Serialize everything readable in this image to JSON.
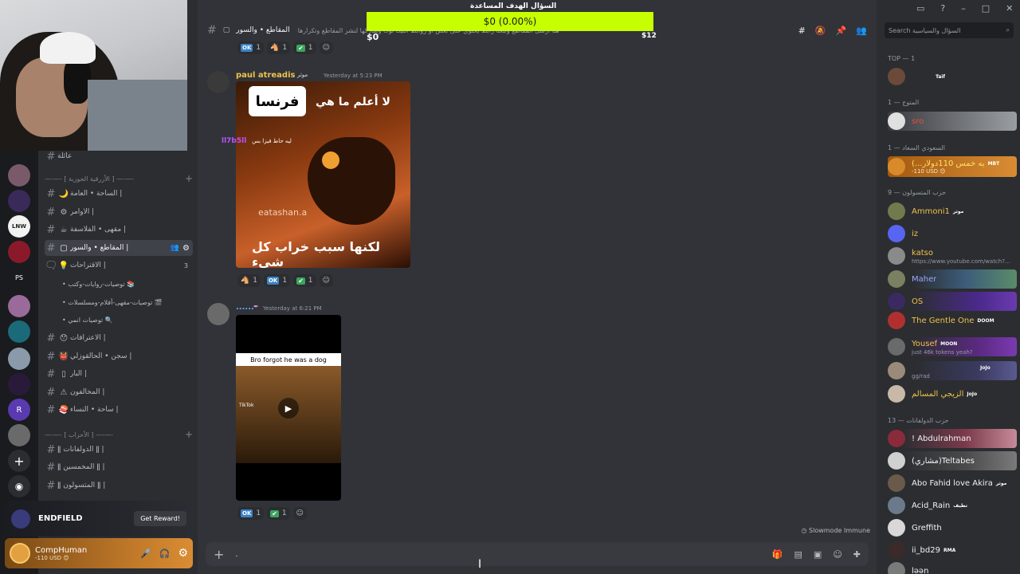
{
  "goal_bar": {
    "amount_label": "$0 (0.00%)",
    "left_label": "$0",
    "right_label": "$12",
    "title": "السؤال الهدف المساعدة",
    "progress_fraction": 0.0
  },
  "channel_header": {
    "name": "المقاطع • والسور",
    "description": "هنا أرسل المقاطع وتبعنا رابط يحتوي على بعض أو روابط التيك توك وشاركها لنشر المقاطع وتكرارها",
    "search_placeholder": "Search السؤال والسياسية"
  },
  "server_rail": {
    "icons": [
      "server-1",
      "server-2",
      "server-3",
      "lnw",
      "server-5",
      "ps",
      "server-7",
      "server-8",
      "server-9",
      "server-10",
      "server-11"
    ],
    "ps_label": "PS",
    "lnw_label": "LNW"
  },
  "channels": {
    "top_label": "عائلة",
    "category_1": "—-—- ⁅ الأزرقية الجوزية ⁆ —-—-",
    "items": [
      {
        "icon": "moon-icon",
        "glyph": "🌙",
        "label": "الساحة • العامة |"
      },
      {
        "icon": "gear-icon",
        "glyph": "⚙",
        "label": "الأوامر |"
      },
      {
        "icon": "coffee-icon",
        "glyph": "☕",
        "label": "مقهى • الفلاسفة |"
      },
      {
        "icon": "frame-icon",
        "glyph": "▢",
        "label": "المقاطع • والسور |"
      },
      {
        "icon": "bulb-icon",
        "glyph": "💡",
        "label": "الاقتراحات |"
      }
    ],
    "threads": [
      {
        "label": "• توصيات-روايات-وكتب 📚"
      },
      {
        "label": "• توصيات-مقهى-أفلام-ومسلسلات 🎬"
      },
      {
        "label": "• توصيات انمي 🔍"
      }
    ],
    "items_2": [
      {
        "icon": "face-icon",
        "glyph": "😯",
        "label": "الأعترافات |"
      },
      {
        "icon": "devil-icon",
        "glyph": "👹",
        "label": "سجن • الحالقوزلي |"
      },
      {
        "icon": "box-icon",
        "glyph": "▯",
        "label": "البار |"
      },
      {
        "icon": "warning-icon",
        "glyph": "⚠",
        "label": "المخالفون |"
      },
      {
        "icon": "sushi-icon",
        "glyph": "🍣",
        "label": "ساحة • النساء |"
      }
    ],
    "suggestions_count": "3",
    "category_2": "—-—- ⁅ الأحزاب ⁆ —-—-",
    "party_items": [
      {
        "label": "ǁ الدولفانات ǁ |"
      },
      {
        "label": "ǁ المخمسين ǁ |"
      },
      {
        "label": "ǁ المتسولون ǁ |"
      }
    ]
  },
  "promo": {
    "title": "ENDFIELD",
    "button": "Get Reward!"
  },
  "user_panel": {
    "name": "CompHuman",
    "status": "-110 USD 😊"
  },
  "messages": {
    "top_reactions": [
      {
        "kind": "ok",
        "count": "1"
      },
      {
        "kind": "emoji",
        "glyph": "🐴",
        "count": "1"
      },
      {
        "kind": "check",
        "count": "1"
      }
    ],
    "msg1": {
      "author": "paul atreadis",
      "badge": "موثر",
      "time": "Yesterday at 5:23 PM",
      "image_top_text": "لا أعلم ما هي",
      "image_box_text": "فرنسا",
      "image_bottom_text": "لكنها سبب خراب كل شيء",
      "watermark": "eatashan.a",
      "reactions": [
        {
          "kind": "emoji",
          "glyph": "🐴",
          "count": "1"
        },
        {
          "kind": "ok",
          "count": "1"
        },
        {
          "kind": "check",
          "count": "1"
        }
      ]
    },
    "floating_user": "ll7b5ll",
    "floating_text": "ليه حاط فيزا بس",
    "msg2": {
      "author": "......",
      "time": "Yesterday at 6:21 PM",
      "video_caption": "Bro forgot he was a dog",
      "video_brand": "TikTok",
      "reactions": [
        {
          "kind": "ok",
          "count": "1"
        },
        {
          "kind": "check",
          "count": "1"
        }
      ]
    },
    "slowmode": "Slowmode Immune",
    "composer_text": "."
  },
  "members": {
    "groups": [
      {
        "label": "TOP — 1"
      },
      {
        "label": "المتوج — 1"
      },
      {
        "label": "السعودي السعاد — 1"
      },
      {
        "label": "حزب المتسولون — 9"
      },
      {
        "label": "حزب الدولفانات — 13"
      }
    ],
    "list": [
      {
        "name": "",
        "tag": "Taif",
        "color": "#c0392b",
        "av": "#6b4a3a",
        "bg": ""
      },
      {
        "name": "sro",
        "tag": "",
        "color": "#e74c3c",
        "av": "#e0e0e0",
        "bg": "linear-gradient(90deg,#3a3b40,#9a9ea3)"
      },
      {
        "name": "(...به خمس 110دولار",
        "tag": "MBT",
        "color": "#ffe066",
        "av": "#d98a2b",
        "bg": "linear-gradient(90deg,#a35a10,#d98c33)",
        "sub": "-110 USD 😊"
      },
      {
        "name": "Ammoni1",
        "tag": "موثر",
        "color": "#f0c24b",
        "av": "#6f7b4d",
        "bg": ""
      },
      {
        "name": "iz",
        "tag": "",
        "color": "#f0c24b",
        "av": "#5865f2",
        "bg": ""
      },
      {
        "name": "katso",
        "tag": "",
        "color": "#f0c24b",
        "av": "#8a8a8a",
        "bg": "",
        "sub": "https://www.youtube.com/watch?..."
      },
      {
        "name": "Maher",
        "tag": "",
        "color": "#9aa7ff",
        "av": "#7a8060",
        "bg": "linear-gradient(90deg,#2b2d31 20%,#3c5c7a 60%,#5a8c6a)"
      },
      {
        "name": "OS",
        "tag": "",
        "color": "#f0c24b",
        "av": "#3a2a60",
        "bg": "linear-gradient(90deg,#2b2d31 20%,#4a2a8a 70%,#6a3ab0)"
      },
      {
        "name": "The Gentle One",
        "tag": "DOOM",
        "color": "#f0c24b",
        "av": "#b03030",
        "bg": ""
      },
      {
        "name": "Yousef",
        "tag": "MOON",
        "color": "#f0c24b",
        "av": "#6a6a6a",
        "bg": "linear-gradient(90deg,#2b2d31 20%,#5a2a80 70%,#7a3ab0)",
        "sub": "just 46k tokens yeah?"
      },
      {
        "name": "",
        "tag": "JoJo",
        "color": "#f0c24b",
        "av": "#9a8a7a",
        "bg": "linear-gradient(90deg,#2b2d31 20%,#3a3a60 70%,#5a5a90)",
        "sub": "gg/rad"
      },
      {
        "name": "الزيجي المسالم",
        "tag": "JoJo",
        "color": "#f0c24b",
        "av": "#c8b8a8",
        "bg": ""
      },
      {
        "name": "! Abdulrahman",
        "tag": "",
        "color": "#f2f3f5",
        "av": "#8a2a3a",
        "bg": "linear-gradient(90deg,#2b2d31 10%,#7a3a4a 60%,#c88a9a)"
      },
      {
        "name": "(مشاري)Teltabes",
        "tag": "",
        "color": "#f2f3f5",
        "av": "#d0d0d0",
        "bg": "linear-gradient(90deg,#2b2d31 10%,#4a4a4a 60%,#7a7a7a)"
      },
      {
        "name": "Abo Fahid love Akira",
        "tag": "موثر",
        "color": "#f2f3f5",
        "av": "#6a5a4a",
        "bg": ""
      },
      {
        "name": "Acid_Rain",
        "tag": "تطيف",
        "color": "#f2f3f5",
        "av": "#6a7a8a",
        "bg": ""
      },
      {
        "name": "Greffith",
        "tag": "",
        "color": "#f2f3f5",
        "av": "#d8d8d8",
        "bg": ""
      },
      {
        "name": "ii_bd29",
        "tag": "RMA",
        "color": "#f2f3f5",
        "av": "#3a2a2a",
        "bg": ""
      },
      {
        "name": "ləən",
        "tag": "",
        "color": "#f2f3f5",
        "av": "#7a7a7a",
        "bg": ""
      }
    ]
  }
}
